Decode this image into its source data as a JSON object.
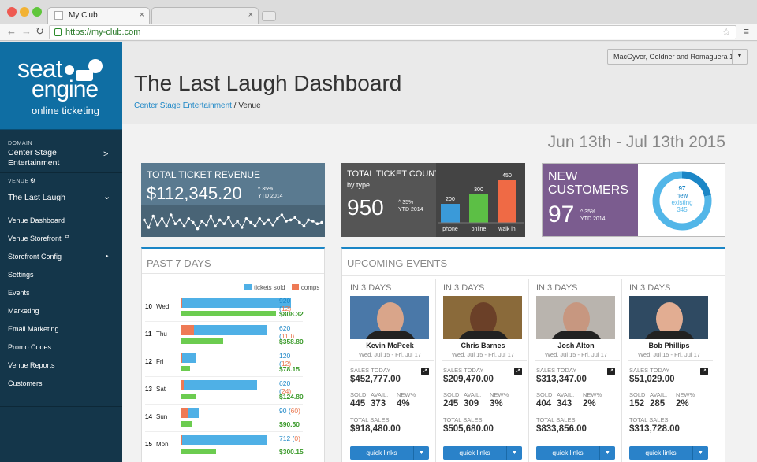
{
  "browser": {
    "tab_title": "My Club",
    "url": "https://my-club.com",
    "dots": [
      "#ee5a52",
      "#f2b233",
      "#5fc63b"
    ]
  },
  "sidebar": {
    "logo": {
      "line1": "seat",
      "line2": "engine",
      "line3": "online ticketing"
    },
    "domain_label": "DOMAIN",
    "domain_value": "Center Stage Entertainment",
    "venue_label": "VENUE",
    "venue_value": "The Last Laugh",
    "items": [
      {
        "label": "Venue Dashboard"
      },
      {
        "label": "Venue Storefront"
      },
      {
        "label": "Storefront Config"
      },
      {
        "label": "Settings"
      },
      {
        "label": "Events"
      },
      {
        "label": "Marketing"
      },
      {
        "label": "Email Marketing"
      },
      {
        "label": "Promo Codes"
      },
      {
        "label": "Venue Reports"
      },
      {
        "label": "Customers"
      }
    ]
  },
  "header": {
    "org_selector": "MacGyver, Goldner and Romaguera 1",
    "title": "The Last Laugh Dashboard",
    "breadcrumb_link": "Center Stage Entertainment",
    "breadcrumb_current": "Venue"
  },
  "date_range": "Jun 13th - Jul 13th 2015",
  "kpi": {
    "revenue": {
      "title": "TOTAL TICKET REVENUE",
      "value": "$112,345.20",
      "delta": "35%",
      "delta_label": "YTD 2014",
      "color": "#5a7a90"
    },
    "count": {
      "title": "TOTAL TICKET COUNT",
      "subtitle": "by type",
      "value": "950",
      "delta": "35%",
      "delta_label": "YTD 2014",
      "color": "#555555"
    },
    "customers": {
      "title_line1": "NEW",
      "title_line2": "CUSTOMERS",
      "value": "97",
      "delta": "35%",
      "delta_label": "YTD 2014",
      "color": "#7b5c8f",
      "donut_new": "97",
      "donut_new_label": "new",
      "donut_existing_label": "existing",
      "donut_existing": "345"
    }
  },
  "chart_data": [
    {
      "type": "line",
      "title": "TOTAL TICKET REVENUE",
      "y": [
        0.55,
        0.25,
        0.7,
        0.35,
        0.6,
        0.3,
        0.75,
        0.4,
        0.55,
        0.3,
        0.6,
        0.45,
        0.2,
        0.5,
        0.35,
        0.7,
        0.3,
        0.55,
        0.4,
        0.65,
        0.3,
        0.5,
        0.25,
        0.6,
        0.45,
        0.3,
        0.6,
        0.4,
        0.55,
        0.35,
        0.6,
        0.75,
        0.5,
        0.55,
        0.65,
        0.45,
        0.3,
        0.55,
        0.5,
        0.4,
        0.45
      ]
    },
    {
      "type": "bar",
      "title": "TOTAL TICKET COUNT",
      "categories": [
        "phone",
        "online",
        "walk in"
      ],
      "values": [
        200,
        300,
        450
      ],
      "colors": [
        "#3a9ad9",
        "#5cbf45",
        "#ef6a45"
      ],
      "ylim": [
        0,
        500
      ]
    },
    {
      "type": "pie",
      "title": "NEW CUSTOMERS",
      "categories": [
        "new",
        "existing"
      ],
      "values": [
        97,
        345
      ],
      "colors": [
        "#1b86c6",
        "#52b6e8"
      ]
    },
    {
      "type": "bar",
      "title": "PAST 7 DAYS",
      "legend": [
        "tickets sold",
        "comps"
      ],
      "colors": {
        "sold": "#4fb0e6",
        "comps": "#ee7a55",
        "revenue": "#6ccc50"
      },
      "xlim": [
        0,
        1000
      ],
      "days": [
        {
          "num": "10",
          "day": "Wed",
          "sold": 920,
          "comps": 12,
          "revenue": "$808.32",
          "rev_value": 808.32
        },
        {
          "num": "11",
          "day": "Thu",
          "sold": 620,
          "comps": 110,
          "revenue": "$358.80",
          "rev_value": 358.8
        },
        {
          "num": "12",
          "day": "Fri",
          "sold": 120,
          "comps": 12,
          "revenue": "$78.15",
          "rev_value": 78.15
        },
        {
          "num": "13",
          "day": "Sat",
          "sold": 620,
          "comps": 24,
          "revenue": "$124.80",
          "rev_value": 124.8
        },
        {
          "num": "14",
          "day": "Sun",
          "sold": 90,
          "comps": 60,
          "revenue": "$90.50",
          "rev_value": 90.5
        },
        {
          "num": "15",
          "day": "Mon",
          "sold": 712,
          "comps": 0,
          "revenue": "$300.15",
          "rev_value": 300.15
        }
      ]
    }
  ],
  "past7": {
    "title": "PAST 7 DAYS"
  },
  "upcoming": {
    "title": "UPCOMING EVENTS",
    "labels": {
      "sales_today": "SALES TODAY",
      "sold": "SOLD",
      "avail": "AVAIL.",
      "newpct": "NEW%",
      "total_sales": "TOTAL SALES",
      "quick_links": "quick links"
    },
    "events": [
      {
        "when": "IN 3 DAYS",
        "name": "Kevin McPeek",
        "dates": "Wed, Jul 15 - Fri, Jul 17",
        "sales_today": "$452,777.00",
        "sold": "445",
        "avail": "373",
        "newpct": "4%",
        "total": "$918,480.00",
        "bg": "#4a78a8",
        "skin": "#d9a58a"
      },
      {
        "when": "IN 3 DAYS",
        "name": "Chris Barnes",
        "dates": "Wed, Jul 15 - Fri, Jul 17",
        "sales_today": "$209,470.00",
        "sold": "245",
        "avail": "309",
        "newpct": "3%",
        "total": "$505,680.00",
        "bg": "#8a6a3a",
        "skin": "#6b4028"
      },
      {
        "when": "IN 3 DAYS",
        "name": "Josh Alton",
        "dates": "Wed, Jul 15 - Fri, Jul 17",
        "sales_today": "$313,347.00",
        "sold": "404",
        "avail": "343",
        "newpct": "2%",
        "total": "$833,856.00",
        "bg": "#b9b4ae",
        "skin": "#c79780"
      },
      {
        "when": "IN 3 DAYS",
        "name": "Bob Phillips",
        "dates": "Wed, Jul 15 - Fri, Jul 17",
        "sales_today": "$51,029.00",
        "sold": "152",
        "avail": "285",
        "newpct": "2%",
        "total": "$313,728.00",
        "bg": "#2f4a62",
        "skin": "#e2ad92"
      }
    ]
  }
}
